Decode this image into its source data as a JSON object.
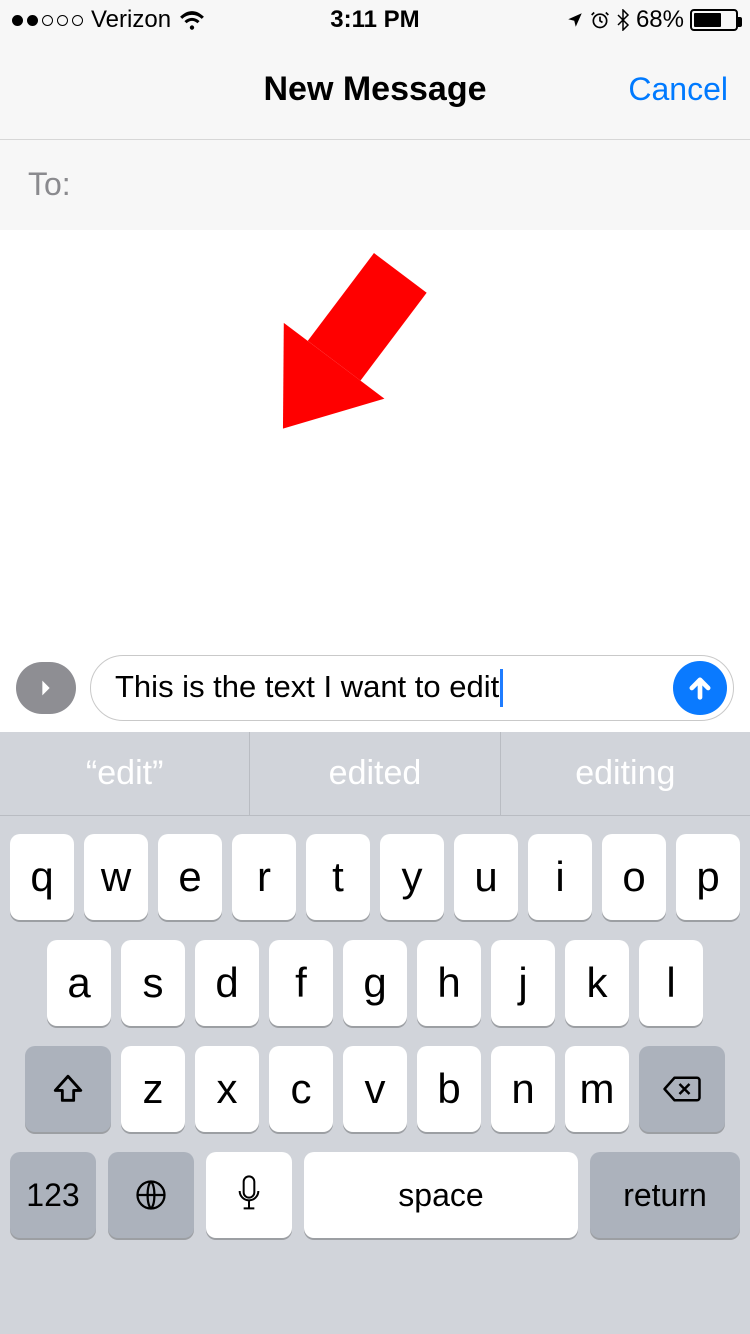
{
  "status": {
    "carrier": "Verizon",
    "signal_filled": 2,
    "signal_total": 5,
    "time": "3:11 PM",
    "battery_percent": "68%",
    "battery_fill_pct": 68
  },
  "nav": {
    "title": "New Message",
    "cancel": "Cancel"
  },
  "compose": {
    "to_label": "To:",
    "message_text": "This is the text I want to edit"
  },
  "keyboard": {
    "suggestions": [
      "“edit”",
      "edited",
      "editing"
    ],
    "row1": [
      "q",
      "w",
      "e",
      "r",
      "t",
      "y",
      "u",
      "i",
      "o",
      "p"
    ],
    "row2": [
      "a",
      "s",
      "d",
      "f",
      "g",
      "h",
      "j",
      "k",
      "l"
    ],
    "row3": [
      "z",
      "x",
      "c",
      "v",
      "b",
      "n",
      "m"
    ],
    "num_key": "123",
    "space_key": "space",
    "return_key": "return"
  }
}
